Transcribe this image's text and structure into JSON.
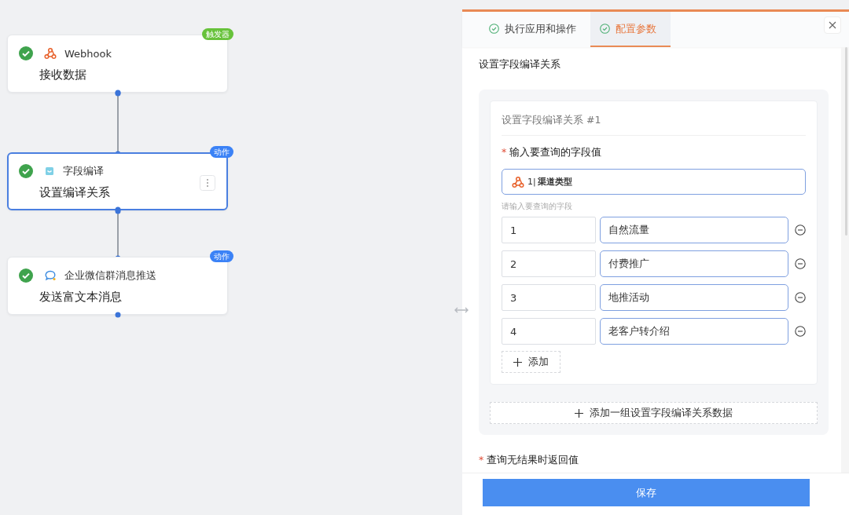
{
  "flow": {
    "nodes": [
      {
        "app": "Webhook",
        "title": "接收数据",
        "badge": "触发器",
        "kind": "trigger",
        "selected": false
      },
      {
        "app": "字段编译",
        "title": "设置编译关系",
        "badge": "动作",
        "kind": "action",
        "selected": true
      },
      {
        "app": "企业微信群消息推送",
        "title": "发送富文本消息",
        "badge": "动作",
        "kind": "action",
        "selected": false
      }
    ]
  },
  "panel": {
    "tabs": [
      {
        "label": "执行应用和操作",
        "selected": false
      },
      {
        "label": "配置参数",
        "selected": true
      }
    ],
    "section_title": "设置字段编译关系",
    "group": {
      "title": "设置字段编译关系 #1",
      "field_label": "输入要查询的字段值",
      "field_required_mark": "*",
      "field_token": {
        "index": "1|",
        "label": "渠道类型"
      },
      "mapping_hint": "请输入要查询的字段",
      "mappings": [
        {
          "key": "1",
          "value": "自然流量"
        },
        {
          "key": "2",
          "value": "付费推广"
        },
        {
          "key": "3",
          "value": "地推活动"
        },
        {
          "key": "4",
          "value": "老客户转介绍"
        }
      ],
      "add_button": "添加"
    },
    "add_group_button": "添加一组设置字段编译关系数据",
    "return_label": "查询无结果时返回值",
    "return_required_mark": "*",
    "save_button": "保存"
  }
}
